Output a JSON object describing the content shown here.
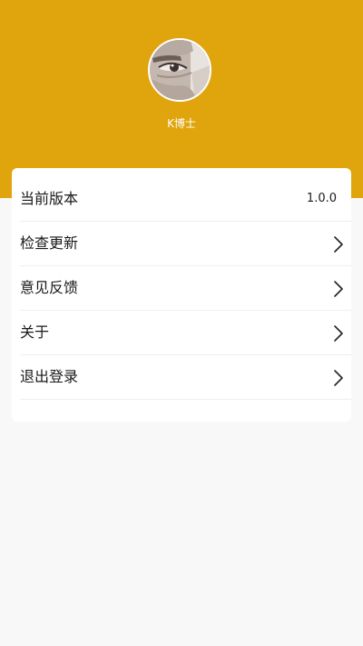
{
  "profile": {
    "username": "K博士",
    "avatar_icon": "user-avatar-photo"
  },
  "menu": {
    "version": {
      "label": "当前版本",
      "value": "1.0.0"
    },
    "check_update": {
      "label": "检查更新",
      "icon": "chevron-right-icon"
    },
    "feedback": {
      "label": "意见反馈",
      "icon": "chevron-right-icon"
    },
    "about": {
      "label": "关于",
      "icon": "chevron-right-icon"
    },
    "logout": {
      "label": "退出登录",
      "icon": "chevron-right-icon"
    }
  },
  "colors": {
    "header_background": "#e0a40c",
    "page_background": "#f8f8f8",
    "card_background": "#ffffff",
    "text": "#1a1a1a"
  }
}
